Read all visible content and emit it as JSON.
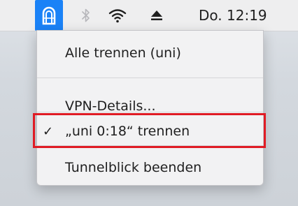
{
  "menubar": {
    "icons": {
      "tunnelblick": "tunnelblick-vpn-icon",
      "bluetooth": "bluetooth-icon",
      "wifi": "wifi-icon",
      "eject": "eject-icon"
    },
    "clock": "Do. 12:19",
    "accent_color": "#1a82f7"
  },
  "menu": {
    "items": [
      {
        "label": "Alle trennen (uni)"
      },
      {
        "label": "VPN-Details..."
      },
      {
        "label": "„uni 0:18“ trennen",
        "checked": true,
        "check_symbol": "✓"
      },
      {
        "label": "Tunnelblick beenden"
      }
    ],
    "highlight_color": "#e01b24"
  }
}
